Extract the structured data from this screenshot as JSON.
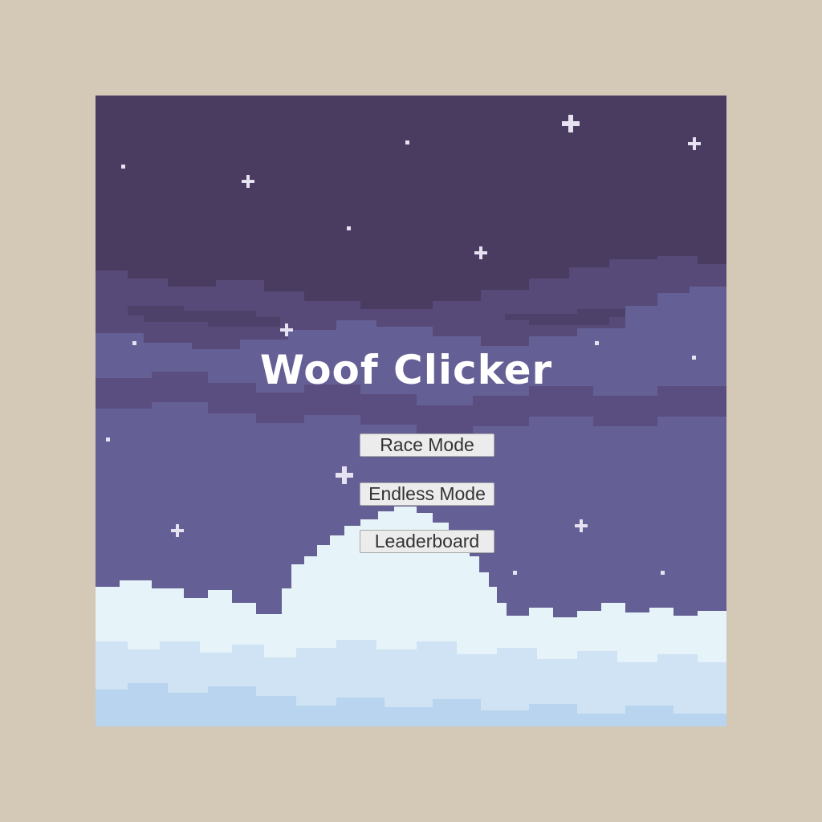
{
  "colors": {
    "page_background": "#d4c8b6",
    "sky_top": "#4a3b60",
    "sky_band": "#574a78",
    "sky_mid": "#645f94",
    "sky_light": "#5f6398",
    "cloud_white": "#e6f3f9",
    "cloud_light": "#cfe3f4",
    "cloud_blue": "#b8d4ee",
    "star": "#e6e2f2",
    "title": "#ffffff"
  },
  "game": {
    "title": "Woof Clicker"
  },
  "menu": {
    "race_mode_label": "Race Mode",
    "endless_mode_label": "Endless Mode",
    "leaderboard_label": "Leaderboard"
  }
}
